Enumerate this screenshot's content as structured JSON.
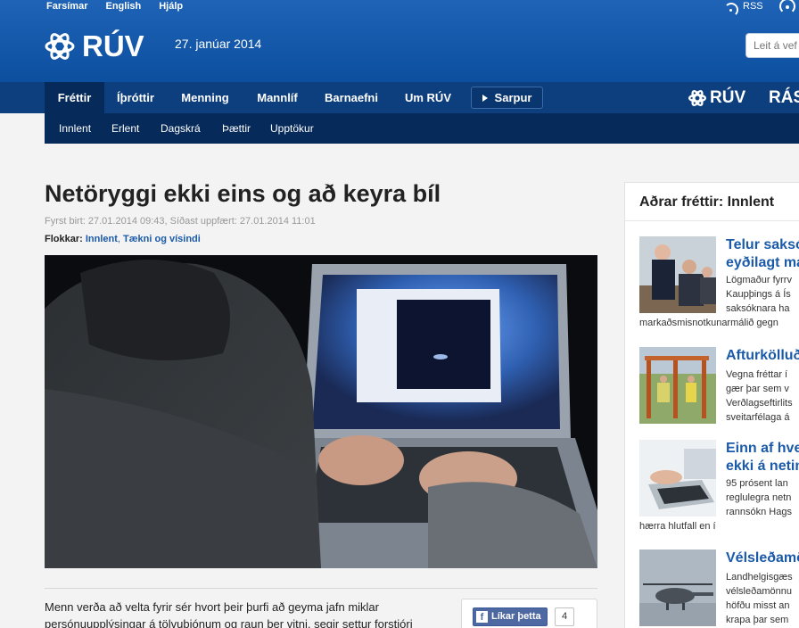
{
  "toplinks": [
    "Farsímar",
    "English",
    "Hjálp"
  ],
  "rss_label": "RSS",
  "brand": {
    "logo_text": "RÚV",
    "date": "27. janúar 2014"
  },
  "search": {
    "placeholder": "Leit á vef"
  },
  "nav": {
    "items": [
      "Fréttir",
      "Íþróttir",
      "Menning",
      "Mannlíf",
      "Barnaefni",
      "Um RÚV"
    ],
    "active": "Fréttir",
    "sarpur_label": "Sarpur",
    "right_logos": [
      "RÚV",
      "RÁS"
    ]
  },
  "subnav": {
    "items": [
      "Innlent",
      "Erlent",
      "Dagskrá",
      "Þættir",
      "Upptökur"
    ]
  },
  "article": {
    "title": "Netöryggi ekki eins og að keyra bíl",
    "meta": "Fyrst birt: 27.01.2014 09:43, Síðast uppfært: 27.01.2014 11:01",
    "categories_label": "Flokkar:",
    "categories": [
      "Innlent",
      "Tækni og vísindi"
    ],
    "body_line1": "Menn verða að velta fyrir sér hvort þeir þurfi að geyma jafn miklar",
    "body_line2": "persónuupplýsingar á tölvuþjónum og raun ber vitni, segir settur forstjóri"
  },
  "share": {
    "like_label": "Líkar þetta",
    "like_count": "4"
  },
  "sidebar": {
    "title": "Aðrar fréttir: Innlent",
    "items": [
      {
        "title": "Telur saksó",
        "title2": "eyðilagt má",
        "lines": [
          "Lögmaður fyrrv",
          "Kaupþings á Ís",
          "saksóknara ha",
          "markaðsmisnotkunarmálið gegn"
        ]
      },
      {
        "title": "Afturkölluð",
        "title2": "",
        "lines": [
          "Vegna fréttar í",
          "gær þar sem v",
          "Verðlagseftirlits",
          "sveitarfélaga á"
        ]
      },
      {
        "title": "Einn af hve",
        "title2": "ekki á netin",
        "lines": [
          "95 prósent lan",
          "reglulegra netn",
          "rannsókn Hags",
          "hærra hlutfall en í"
        ]
      },
      {
        "title": "Vélsleðamö",
        "title2": "",
        "lines": [
          "Landhelgisgæs",
          "vélsleðamönnu",
          "höfðu misst an",
          "krapa þar sem"
        ]
      }
    ]
  }
}
